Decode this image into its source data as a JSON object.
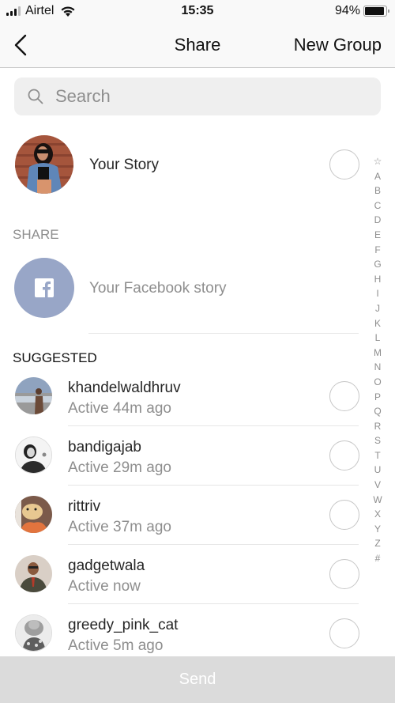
{
  "status_bar": {
    "carrier": "Airtel",
    "time": "15:35",
    "battery_percent": "94%",
    "battery_level": 0.94
  },
  "navbar": {
    "back_icon": "chevron-left-icon",
    "title": "Share",
    "right_action": "New Group"
  },
  "search": {
    "placeholder": "Search",
    "value": "",
    "icon": "search-icon"
  },
  "your_story": {
    "label": "Your Story",
    "selected": false
  },
  "share_section": {
    "header": "SHARE",
    "facebook_story_label": "Your Facebook story",
    "icon": "facebook-icon",
    "color": "#98a6c7"
  },
  "suggested_section": {
    "header": "SUGGESTED",
    "items": [
      {
        "username": "khandelwaldhruv",
        "status": "Active 44m ago",
        "selected": false
      },
      {
        "username": "bandigajab",
        "status": "Active 29m ago",
        "selected": false
      },
      {
        "username": "rittriv",
        "status": "Active 37m ago",
        "selected": false
      },
      {
        "username": "gadgetwala",
        "status": "Active now",
        "selected": false
      },
      {
        "username": "greedy_pink_cat",
        "status": "Active 5m ago",
        "selected": false
      }
    ]
  },
  "alphabet_index": [
    "☆",
    "A",
    "B",
    "C",
    "D",
    "E",
    "F",
    "G",
    "H",
    "I",
    "J",
    "K",
    "L",
    "M",
    "N",
    "O",
    "P",
    "Q",
    "R",
    "S",
    "T",
    "U",
    "V",
    "W",
    "X",
    "Y",
    "Z",
    "#"
  ],
  "send_button": {
    "label": "Send",
    "enabled": false
  }
}
